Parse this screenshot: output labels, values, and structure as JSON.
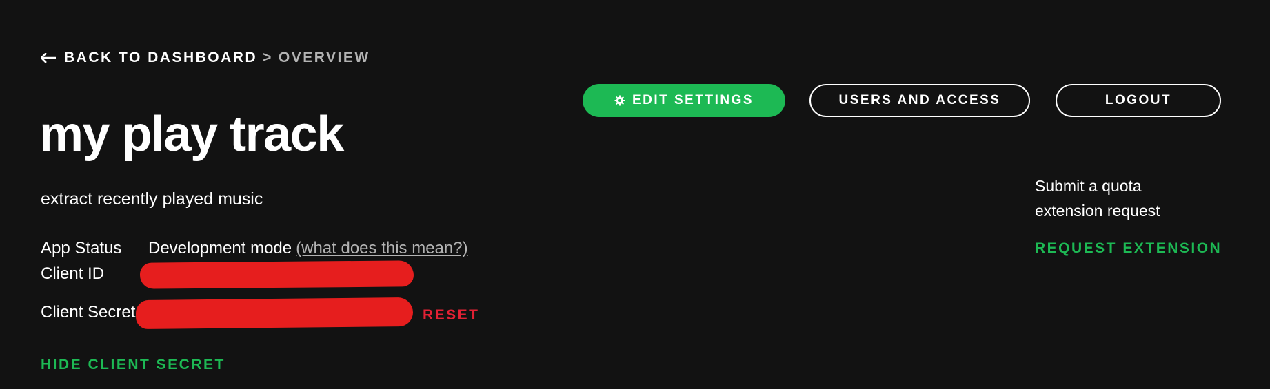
{
  "breadcrumb": {
    "back_label": "BACK TO DASHBOARD",
    "separator": ">",
    "current": "OVERVIEW"
  },
  "app": {
    "name": "my play track",
    "description": "extract recently played music"
  },
  "details": {
    "status_label": "App Status",
    "status_value": "Development mode",
    "status_help": "(what does this mean?)",
    "client_id_label": "Client ID",
    "client_secret_label": "Client Secret",
    "reset_label": "RESET",
    "hide_secret_label": "HIDE CLIENT SECRET"
  },
  "actions": {
    "edit_settings": "EDIT SETTINGS",
    "users_and_access": "USERS AND ACCESS",
    "logout": "LOGOUT"
  },
  "quota": {
    "text": "Submit a quota extension request",
    "request_label": "REQUEST EXTENSION"
  },
  "colors": {
    "background": "#121212",
    "accent_green": "#1db954",
    "danger_red": "#e22134",
    "muted_text": "#b3b3b3"
  }
}
